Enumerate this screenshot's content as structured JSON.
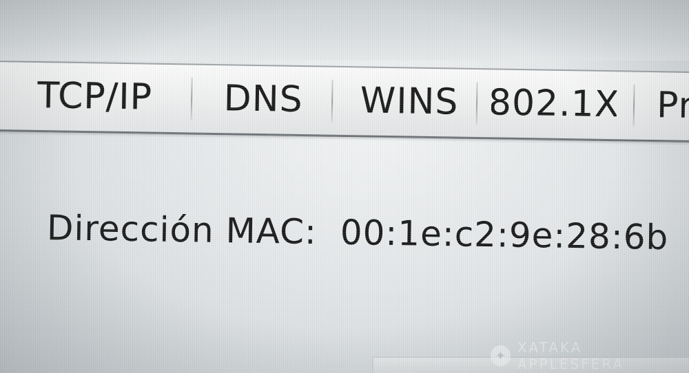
{
  "tabs": [
    {
      "label": "TCP/IP",
      "selected": true
    },
    {
      "label": "DNS",
      "selected": false
    },
    {
      "label": "WINS",
      "selected": false
    },
    {
      "label": "802.1X",
      "selected": false
    },
    {
      "label": "Pr",
      "selected": false
    }
  ],
  "mac": {
    "label": "Dirección MAC:",
    "value": "00:1e:c2:9e:28:6b"
  },
  "watermark": {
    "text": "XATAKA APPLESFERA"
  }
}
